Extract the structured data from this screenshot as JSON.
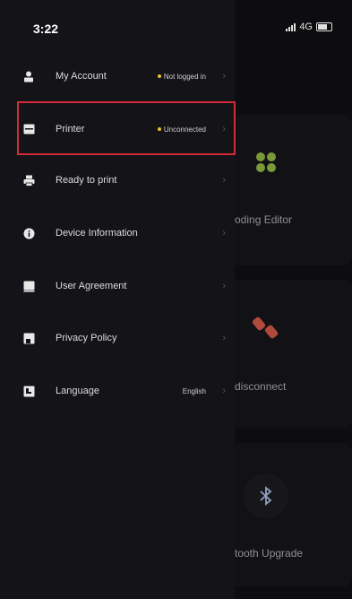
{
  "status_bar": {
    "time": "3:22",
    "network": "4G"
  },
  "drawer": {
    "items": [
      {
        "label": "My Account",
        "status": "Not logged in",
        "icon": "user-icon"
      },
      {
        "label": "Printer",
        "status": "Unconnected",
        "icon": "printer-icon"
      },
      {
        "label": "Ready to print",
        "status": "",
        "icon": "print-queue-icon"
      },
      {
        "label": "Device Information",
        "status": "",
        "icon": "info-icon"
      },
      {
        "label": "User Agreement",
        "status": "",
        "icon": "document-icon"
      },
      {
        "label": "Privacy Policy",
        "status": "",
        "icon": "shield-document-icon"
      },
      {
        "label": "Language",
        "value": "English",
        "icon": "language-icon"
      }
    ]
  },
  "background_app": {
    "cards": [
      {
        "label": "oding Editor",
        "icon": "grid-icon"
      },
      {
        "label": "disconnect",
        "icon": "link-broken-icon"
      },
      {
        "label": "tooth Upgrade",
        "icon": "bluetooth-icon"
      }
    ]
  },
  "colors": {
    "status_dot": "#f0c020",
    "highlight": "#d42a3a",
    "grid_icon": "#7a9a3a",
    "disconnect_icon": "#b04a3a",
    "bluetooth_icon": "#8fa0c0"
  }
}
